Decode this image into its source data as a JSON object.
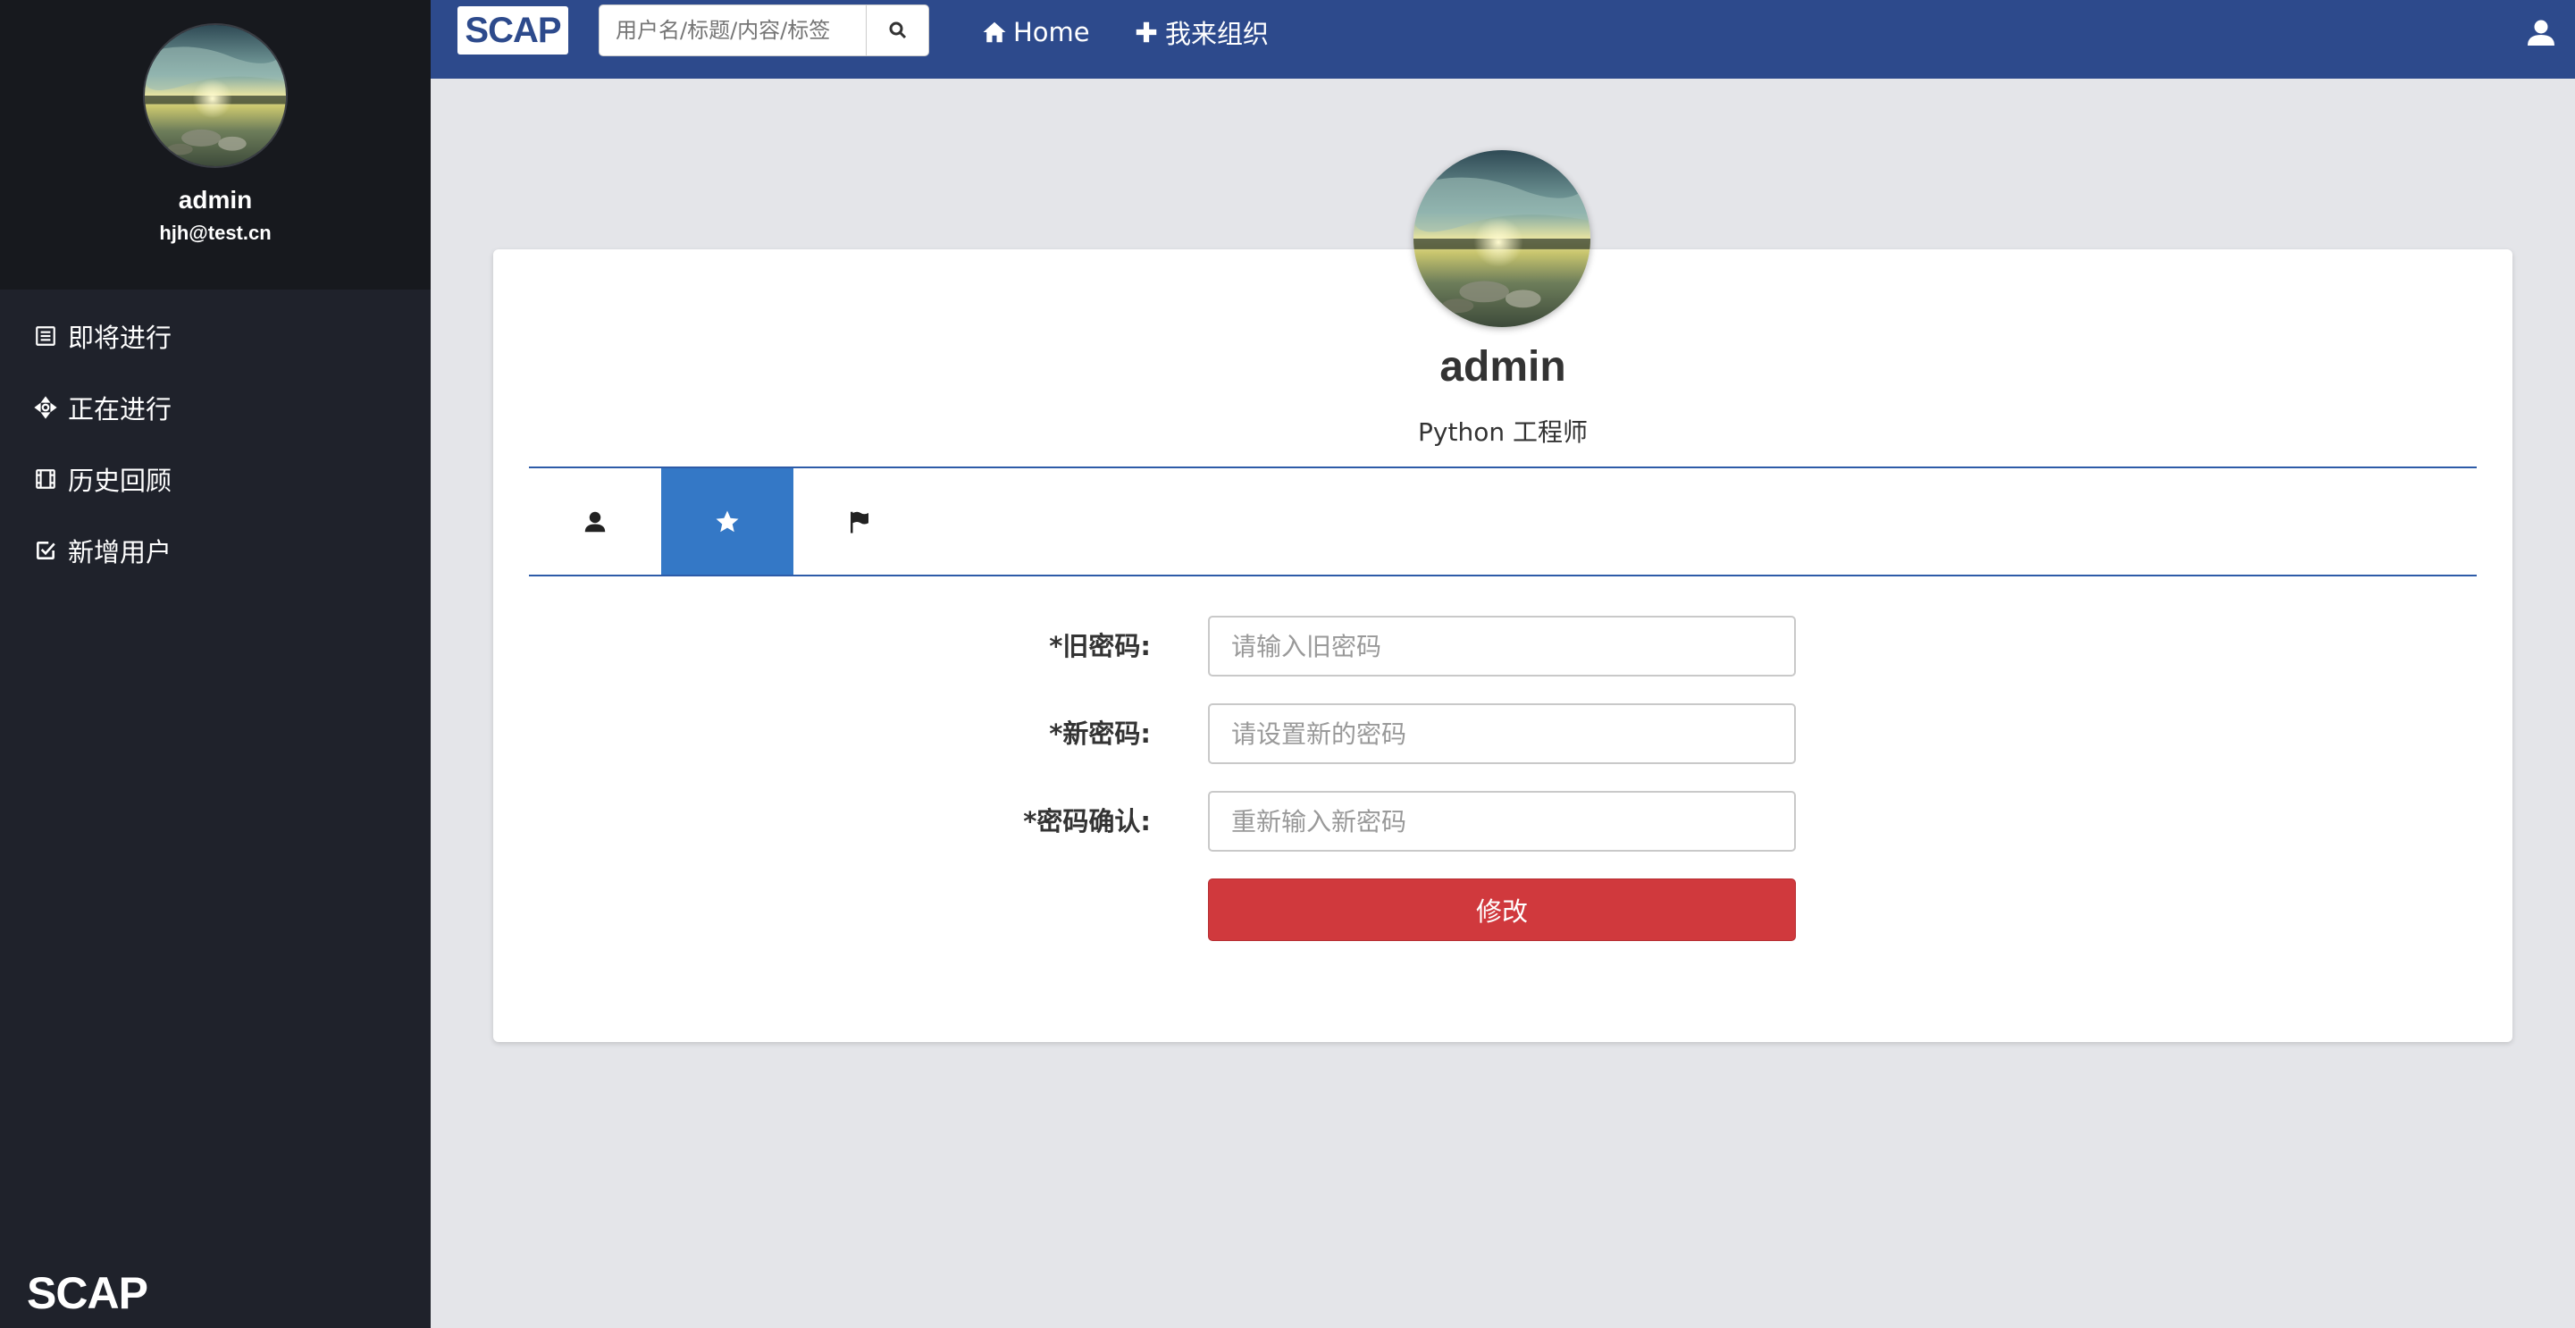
{
  "sidebar": {
    "name": "admin",
    "email": "hjh@test.cn",
    "items": [
      {
        "icon": "list-icon",
        "label": "即将进行"
      },
      {
        "icon": "move-icon",
        "label": "正在进行"
      },
      {
        "icon": "film-icon",
        "label": "历史回顾"
      },
      {
        "icon": "check-square-icon",
        "label": "新增用户"
      }
    ],
    "brand": "SCAP"
  },
  "topbar": {
    "logo": "SCAP",
    "search_placeholder": "用户名/标题/内容/标签",
    "home_label": "Home",
    "org_label": "我来组织",
    "color": "#2d4a8c"
  },
  "profile": {
    "name": "admin",
    "title": "Python 工程师"
  },
  "tabs": [
    {
      "icon": "user-icon",
      "active": false
    },
    {
      "icon": "star-icon",
      "active": true
    },
    {
      "icon": "flag-icon",
      "active": false
    }
  ],
  "form": {
    "old_password_label": "*旧密码:",
    "old_password_placeholder": "请输入旧密码",
    "new_password_label": "*新密码:",
    "new_password_placeholder": "请设置新的密码",
    "confirm_label": "*密码确认:",
    "confirm_placeholder": "重新输入新密码",
    "submit_label": "修改",
    "submit_color": "#d0393d"
  }
}
